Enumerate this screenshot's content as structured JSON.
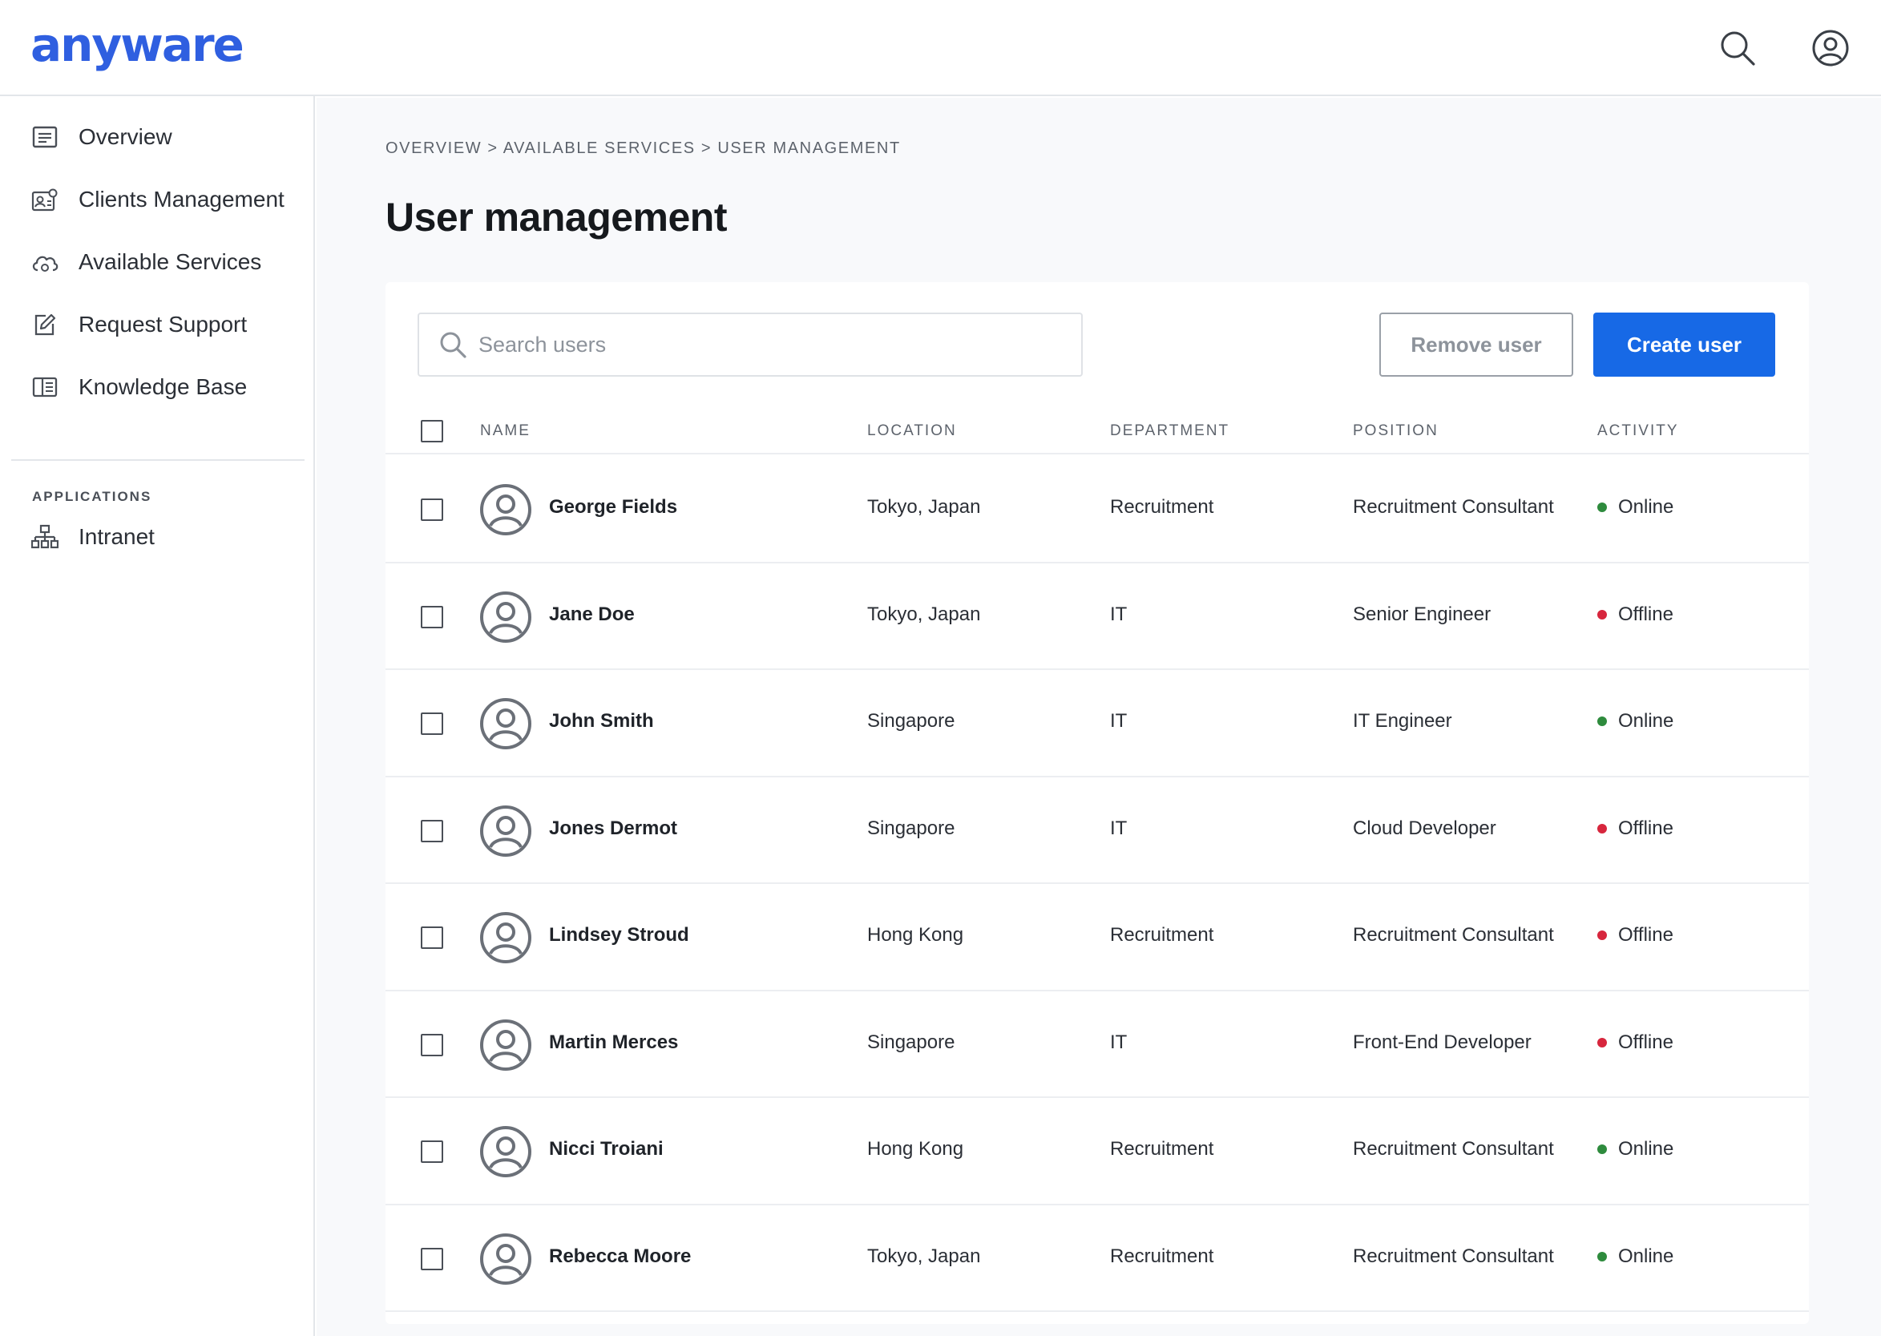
{
  "brand": {
    "logo_text": "anyware",
    "accent_color": "#2f5fe0"
  },
  "header": {
    "icons": [
      "search-icon",
      "account-icon"
    ]
  },
  "sidebar": {
    "items": [
      {
        "label": "Overview",
        "icon": "overview-icon"
      },
      {
        "label": "Clients Management",
        "icon": "clients-icon"
      },
      {
        "label": "Available Services",
        "icon": "cloud-services-icon"
      },
      {
        "label": "Request Support",
        "icon": "edit-icon"
      },
      {
        "label": "Knowledge Base",
        "icon": "book-icon"
      }
    ],
    "section_label": "APPLICATIONS",
    "apps": [
      {
        "label": "Intranet",
        "icon": "sitemap-icon"
      }
    ]
  },
  "main": {
    "breadcrumb": "OVERVIEW > AVAILABLE SERVICES > USER MANAGEMENT",
    "title": "User management",
    "search": {
      "placeholder": "Search users",
      "value": ""
    },
    "buttons": {
      "remove": "Remove user",
      "create": "Create user"
    },
    "table": {
      "columns": [
        "NAME",
        "LOCATION",
        "DEPARTMENT",
        "POSITION",
        "ACTIVITY"
      ],
      "rows": [
        {
          "name": "George Fields",
          "location": "Tokyo, Japan",
          "department": "Recruitment",
          "position": "Recruitment Consultant",
          "activity": "Online"
        },
        {
          "name": "Jane Doe",
          "location": "Tokyo, Japan",
          "department": "IT",
          "position": "Senior Engineer",
          "activity": "Offline"
        },
        {
          "name": "John Smith",
          "location": "Singapore",
          "department": "IT",
          "position": "IT Engineer",
          "activity": "Online"
        },
        {
          "name": "Jones Dermot",
          "location": "Singapore",
          "department": "IT",
          "position": "Cloud Developer",
          "activity": "Offline"
        },
        {
          "name": "Lindsey Stroud",
          "location": "Hong Kong",
          "department": "Recruitment",
          "position": "Recruitment Consultant",
          "activity": "Offline"
        },
        {
          "name": "Martin Merces",
          "location": "Singapore",
          "department": "IT",
          "position": "Front-End Developer",
          "activity": "Offline"
        },
        {
          "name": "Nicci Troiani",
          "location": "Hong Kong",
          "department": "Recruitment",
          "position": "Recruitment Consultant",
          "activity": "Online"
        },
        {
          "name": "Rebecca Moore",
          "location": "Tokyo, Japan",
          "department": "Recruitment",
          "position": "Recruitment Consultant",
          "activity": "Online"
        }
      ]
    },
    "status_colors": {
      "Online": "#2e8b3d",
      "Offline": "#d7263d"
    },
    "primary_button_color": "#1769e6"
  }
}
